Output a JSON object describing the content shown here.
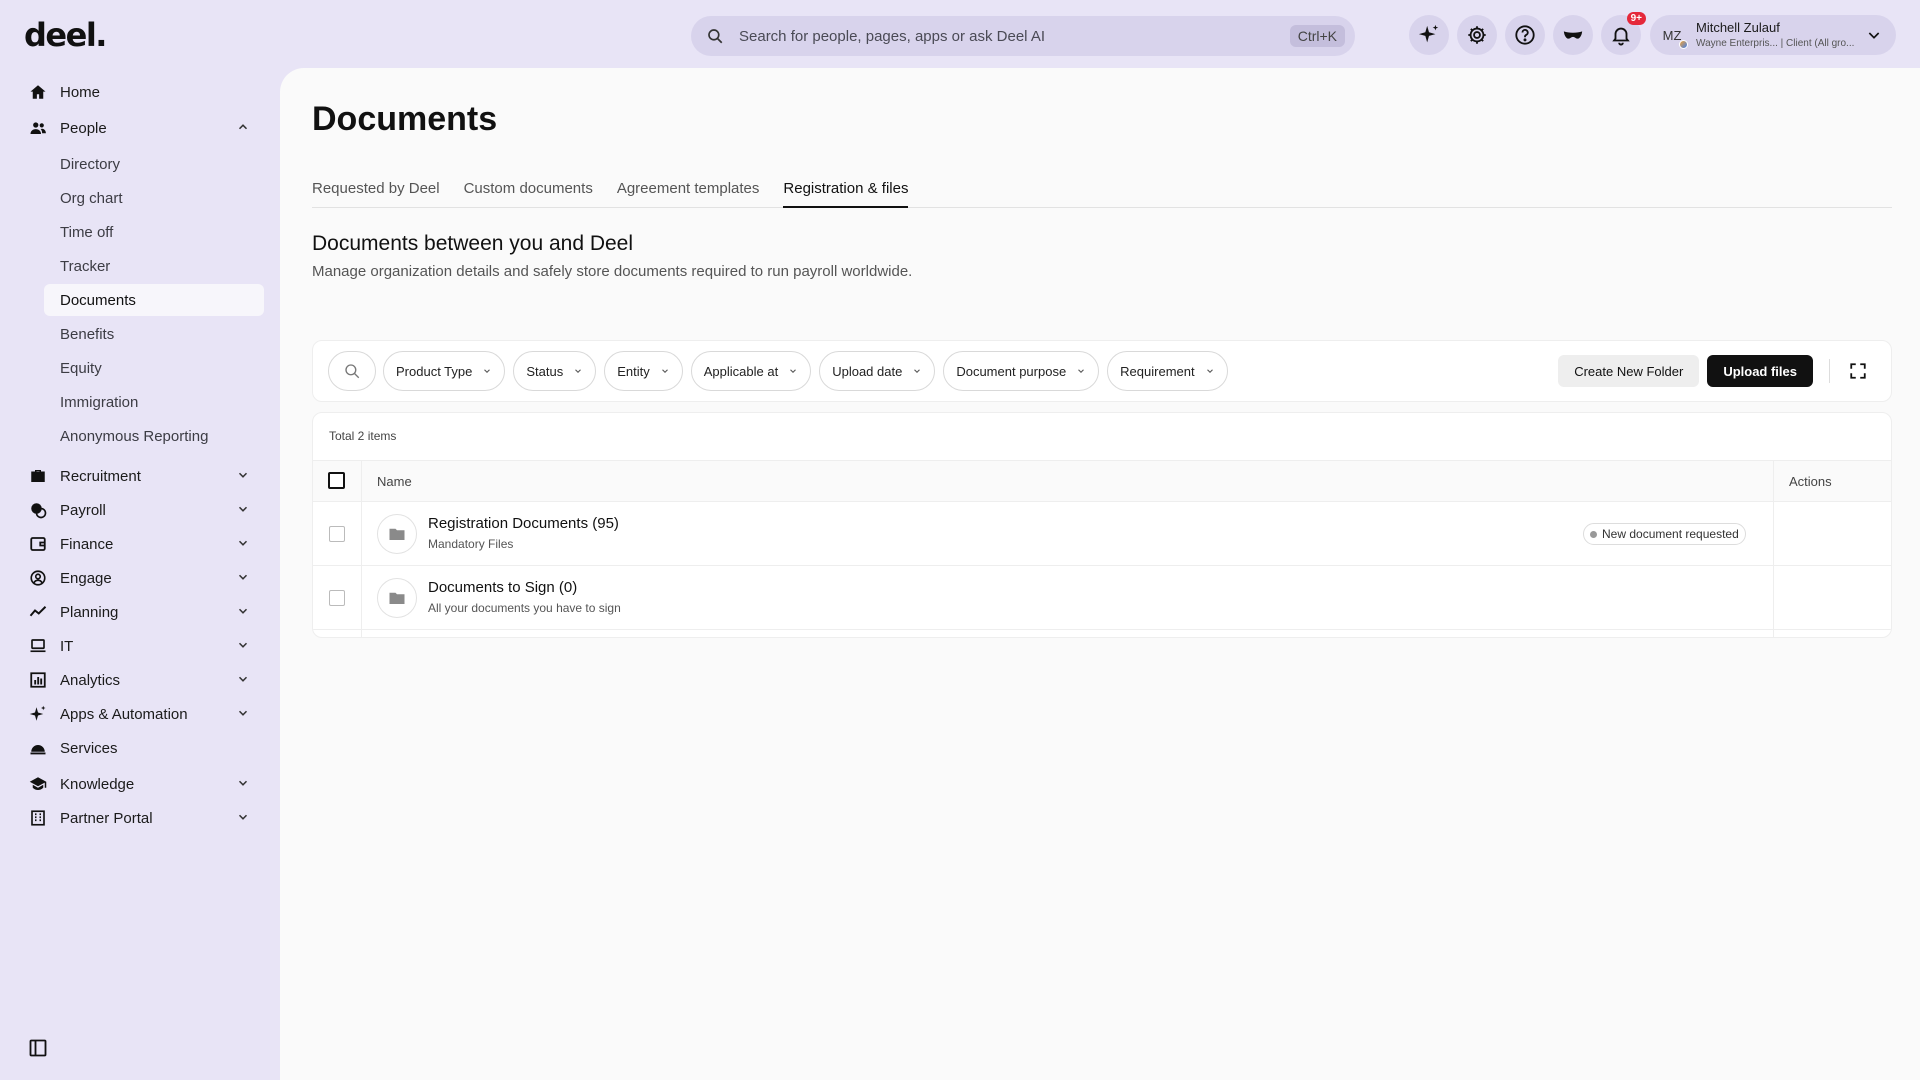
{
  "brand": {
    "logo": "deel."
  },
  "search": {
    "placeholder": "Search for people, pages, apps or ask Deel AI",
    "shortcut": "Ctrl+K"
  },
  "topbar": {
    "icons": [
      "sparkle-icon",
      "gear-icon",
      "help-icon",
      "mask-icon",
      "bell-icon"
    ],
    "notifications_badge": "9+"
  },
  "user": {
    "initials": "MZ",
    "name": "Mitchell Zulauf",
    "subtitle": "Wayne Enterpris... | Client (All gro..."
  },
  "sidebar": {
    "home": "Home",
    "people": "People",
    "people_sub": [
      "Directory",
      "Org chart",
      "Time off",
      "Tracker",
      "Documents",
      "Benefits",
      "Equity",
      "Immigration",
      "Anonymous Reporting"
    ],
    "active_sub": "Documents",
    "sections": [
      "Recruitment",
      "Payroll",
      "Finance",
      "Engage",
      "Planning",
      "IT",
      "Analytics",
      "Apps & Automation",
      "Services",
      "Knowledge",
      "Partner Portal"
    ]
  },
  "page": {
    "title": "Documents",
    "tabs": [
      "Requested by Deel",
      "Custom documents",
      "Agreement templates",
      "Registration & files"
    ],
    "active_tab": "Registration & files",
    "section_title": "Documents between you and Deel",
    "section_desc": "Manage organization details and safely store documents required to run payroll worldwide."
  },
  "filters": [
    "Product Type",
    "Status",
    "Entity",
    "Applicable at",
    "Upload date",
    "Document purpose",
    "Requirement"
  ],
  "actions": {
    "create_folder": "Create New Folder",
    "upload": "Upload files"
  },
  "table": {
    "total": "Total 2 items",
    "columns": {
      "name": "Name",
      "actions": "Actions"
    },
    "rows": [
      {
        "name": "Registration Documents (95)",
        "sub": "Mandatory Files",
        "badge": "New document requested"
      },
      {
        "name": "Documents to Sign (0)",
        "sub": "All your documents you have to sign",
        "badge": ""
      }
    ]
  },
  "colors": {
    "background": "#e8e4f6",
    "primary_button": "#111111",
    "badge_red": "#e5283a"
  }
}
